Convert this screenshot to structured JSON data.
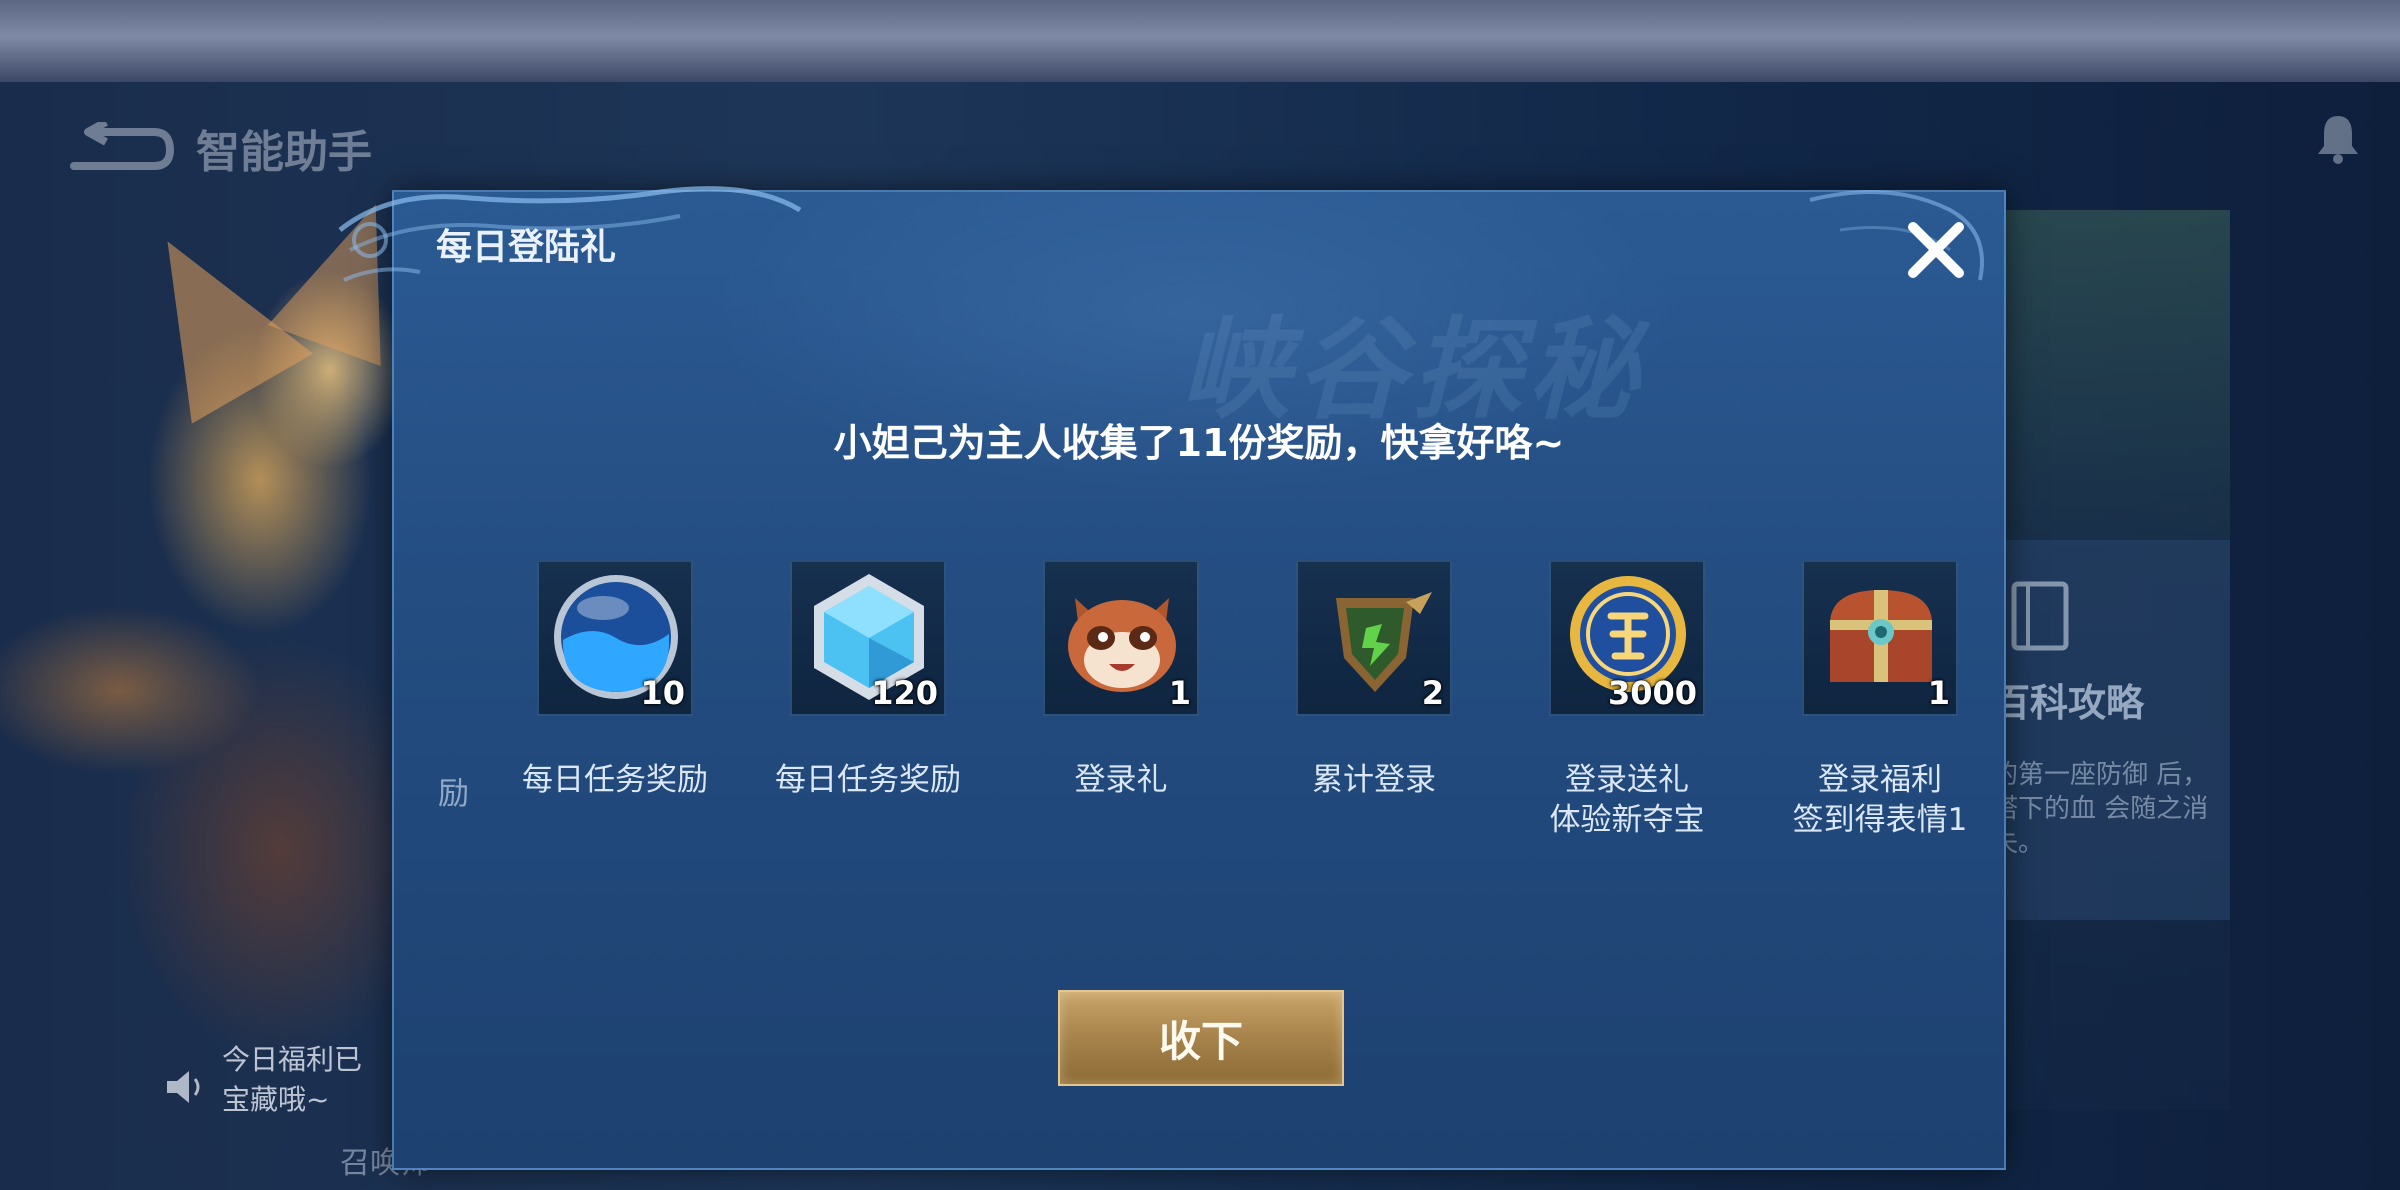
{
  "background": {
    "header_title": "智能助手",
    "right_card_title": "百科攻略",
    "right_card_desc": "的第一座防御 后，塔下的血 会随之消失。",
    "notice_text": "今日福利已 宝藏哦~",
    "bottom_label": "召唤师",
    "partial_reward_label": "励"
  },
  "dialog": {
    "title": "每日登陆礼",
    "watermark": "峡谷探秘",
    "subtitle": "小妲己为主人收集了11份奖励，快拿好咯~",
    "accept_label": "收下",
    "rewards": [
      {
        "icon": "blue-orb-icon",
        "count": "10",
        "label": "每日任务奖励",
        "label2": ""
      },
      {
        "icon": "crystal-hexagon-icon",
        "count": "120",
        "label": "每日任务奖励",
        "label2": ""
      },
      {
        "icon": "raccoon-emote-icon",
        "count": "1",
        "label": "登录礼",
        "label2": ""
      },
      {
        "icon": "shield-badge-icon",
        "count": "2",
        "label": "累计登录",
        "label2": ""
      },
      {
        "icon": "gold-coupon-icon",
        "count": "3000",
        "label": "登录送礼",
        "label2": "体验新夺宝"
      },
      {
        "icon": "treasure-chest-icon",
        "count": "1",
        "label": "登录福利",
        "label2": "签到得表情1"
      }
    ]
  },
  "colors": {
    "dialog_bg": "#234c80",
    "accent_gold": "#c9a56b",
    "text_light": "#dbe7f6"
  }
}
